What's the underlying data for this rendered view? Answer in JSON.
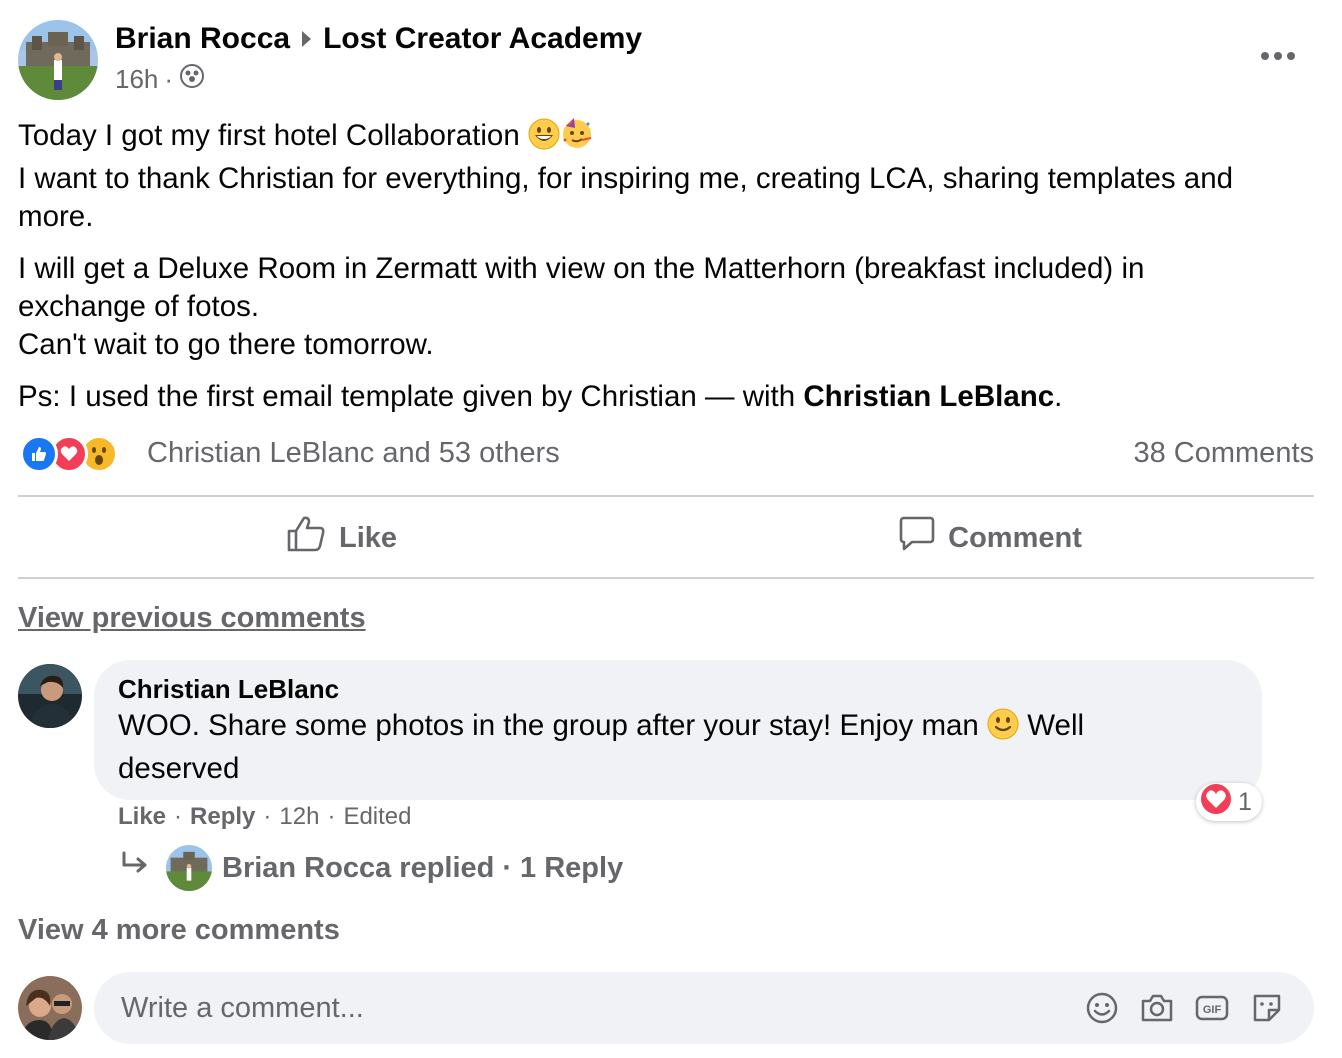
{
  "post": {
    "author": "Brian Rocca",
    "group": "Lost Creator Academy",
    "time": "16h",
    "separator": "·",
    "paragraphs": {
      "p1_line1": "Today I got my  first hotel Collaboration",
      "p1_line2": "I want to thank Christian for everything, for inspiring me, creating LCA, sharing templates and",
      "p1_line3": "more.",
      "p2_line1": "I will get a Deluxe Room in Zermatt with view on the Matterhorn (breakfast included) in",
      "p2_line2": "exchange of fotos.",
      "p2_line3": "Can't wait to go there tomorrow.",
      "p3_text": "Ps: I used the first email template given by Christian — with ",
      "p3_tag": "Christian LeBlanc",
      "p3_end": "."
    },
    "reactions_text": "Christian LeBlanc and 53 others",
    "comments_count": "38 Comments",
    "reaction_icons": [
      "like-icon",
      "love-icon",
      "wow-icon"
    ]
  },
  "actions": {
    "like": "Like",
    "comment": "Comment"
  },
  "comments": {
    "view_previous": "View previous comments",
    "item": {
      "author": "Christian LeBlanc",
      "text_a": "WOO. Share some photos in the group after your stay! Enjoy man",
      "text_b": " Well",
      "text_c": "deserved",
      "like": "Like",
      "reply": "Reply",
      "time": "12h",
      "edited": "Edited",
      "dot": "·",
      "reaction_count": "1"
    },
    "reply_summary": {
      "author": "Brian Rocca replied",
      "dot": "·",
      "count": "1 Reply"
    },
    "view_more": "View 4 more comments"
  },
  "composer": {
    "placeholder": "Write a comment..."
  },
  "colors": {
    "secondary_text": "#65676b",
    "bubble_bg": "#f0f2f5",
    "like_blue": "#1877f2",
    "love_red": "#f33e58",
    "wow_yellow": "#f7b928"
  }
}
